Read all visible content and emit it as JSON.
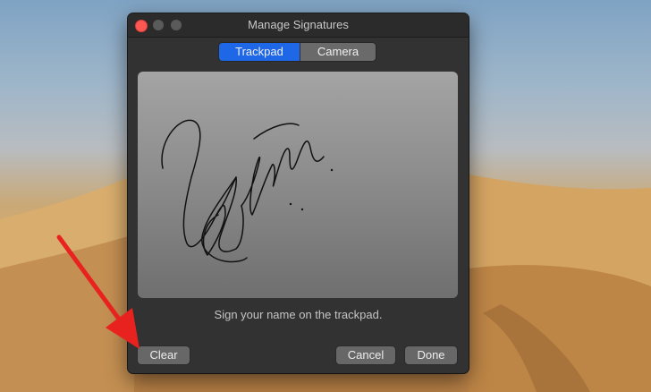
{
  "window": {
    "title": "Manage Signatures"
  },
  "tabs": [
    {
      "label": "Trackpad",
      "selected": true
    },
    {
      "label": "Camera",
      "selected": false
    }
  ],
  "pad": {
    "hint": "Sign your name on the trackpad."
  },
  "buttons": {
    "clear": "Clear",
    "cancel": "Cancel",
    "done": "Done"
  },
  "colors": {
    "accent": "#1e67e6",
    "close": "#fc5753",
    "annotation_arrow": "#e8231f"
  }
}
